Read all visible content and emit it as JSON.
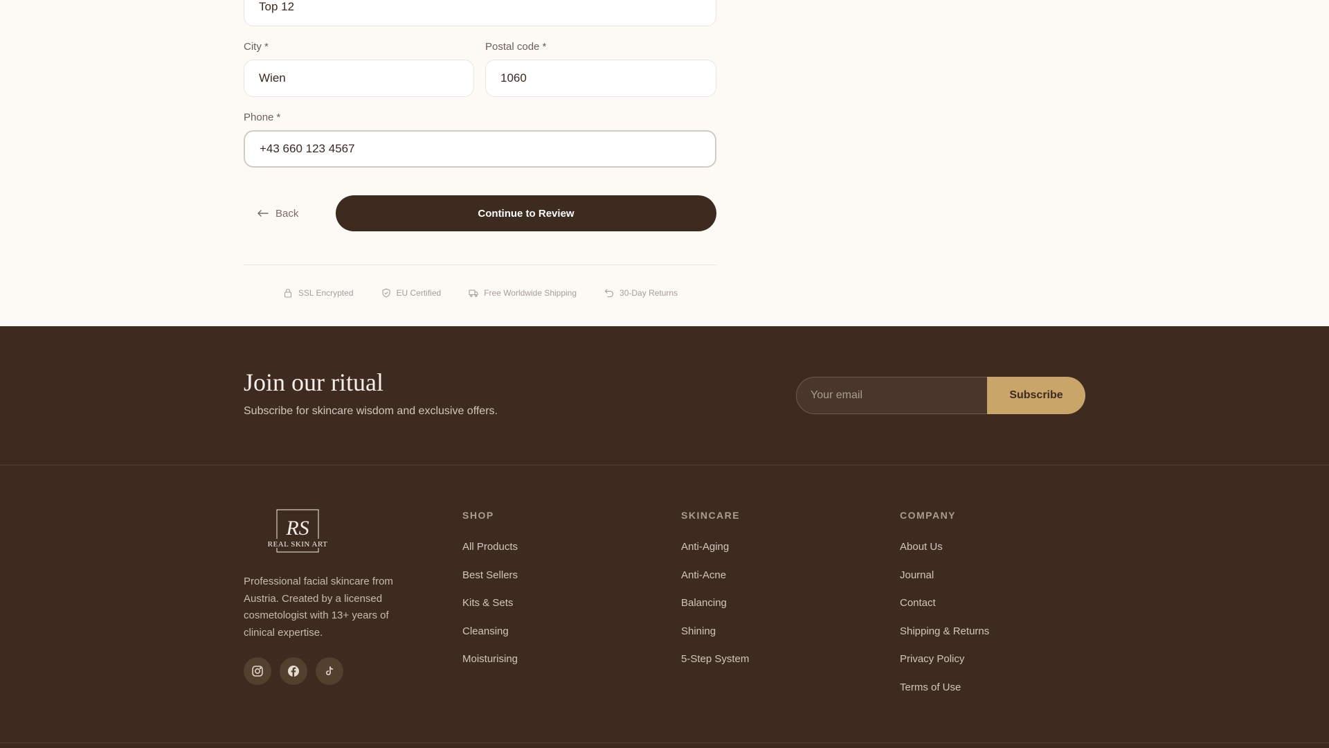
{
  "form": {
    "address_line2_value": "Top 12",
    "city_label": "City *",
    "city_value": "Wien",
    "postal_label": "Postal code *",
    "postal_value": "1060",
    "phone_label": "Phone *",
    "phone_value": "+43 660 123 4567",
    "back_label": "Back",
    "continue_label": "Continue to Review"
  },
  "trust": {
    "ssl": "SSL Encrypted",
    "eu": "EU Certified",
    "shipping": "Free Worldwide Shipping",
    "returns": "30-Day Returns"
  },
  "newsletter": {
    "title": "Join our ritual",
    "subtitle": "Subscribe for skincare wisdom and exclusive offers.",
    "email_placeholder": "Your email",
    "subscribe_label": "Subscribe"
  },
  "brand": {
    "monogram": "RS",
    "name": "REAL SKIN ART",
    "description": "Professional facial skincare from Austria. Created by a licensed cosmetologist with 13+ years of clinical expertise."
  },
  "social": [
    "instagram-icon",
    "facebook-icon",
    "tiktok-icon"
  ],
  "columns": {
    "shop": {
      "title": "SHOP",
      "links": [
        "All Products",
        "Best Sellers",
        "Kits & Sets",
        "Cleansing",
        "Moisturising"
      ]
    },
    "skincare": {
      "title": "SKINCARE",
      "links": [
        "Anti-Aging",
        "Anti-Acne",
        "Balancing",
        "Shining",
        "5-Step System"
      ]
    },
    "company": {
      "title": "COMPANY",
      "links": [
        "About Us",
        "Journal",
        "Contact",
        "Shipping & Returns",
        "Privacy Policy",
        "Terms of Use"
      ]
    }
  },
  "colors": {
    "background": "#fdfaf6",
    "footer": "#3d2b20",
    "accent_gold": "#c9a56a",
    "primary_button": "#3d2b20"
  }
}
